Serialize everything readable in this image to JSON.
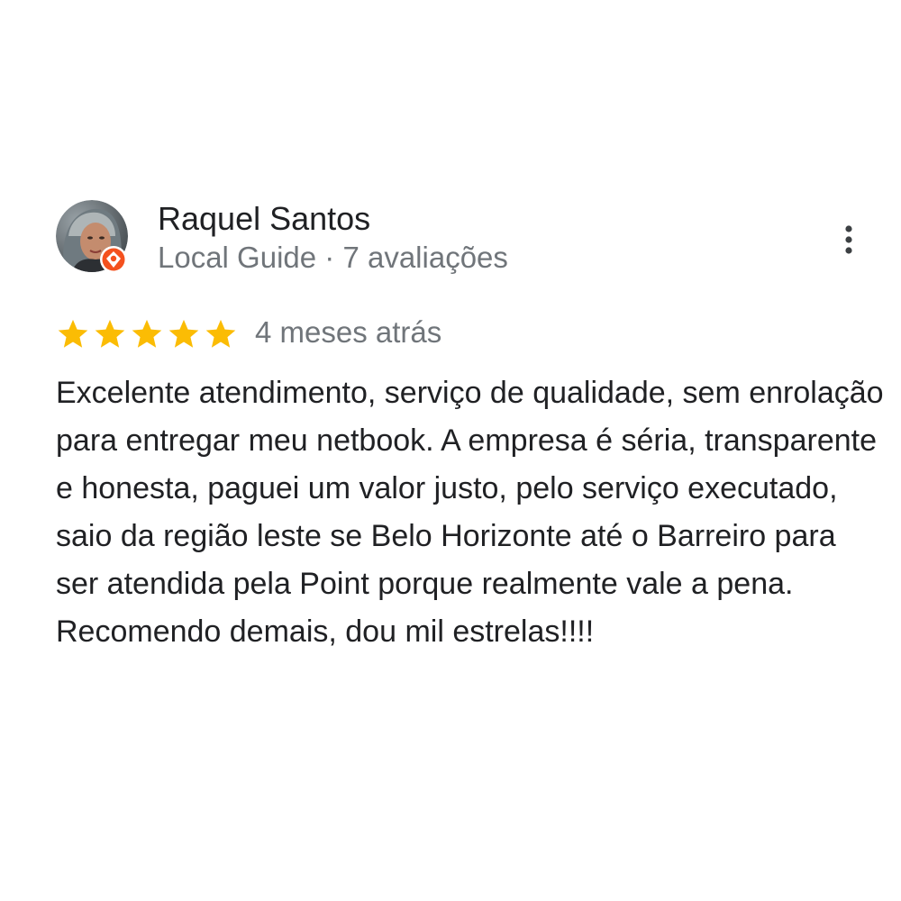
{
  "review": {
    "reviewer": {
      "name": "Raquel Santos",
      "meta": "Local Guide · 7 avaliações",
      "avatar_icon": "user-avatar-photo",
      "badge_icon": "local-guide-badge-icon",
      "badge_color": "#f4511e"
    },
    "rating": {
      "stars": 5,
      "max_stars": 5,
      "star_color": "#fbbc04"
    },
    "date": "4 meses atrás",
    "text": "Excelente atendimento, serviço de qualidade, sem enrolação para entregar meu netbook. A empresa é séria, transparente e honesta, paguei um valor justo, pelo serviço executado, saio da região leste se Belo Horizonte até o Barreiro para ser atendida pela Point porque realmente vale a pena. Recomendo demais, dou mil estrelas!!!!",
    "more_icon": "more-vert-icon"
  }
}
